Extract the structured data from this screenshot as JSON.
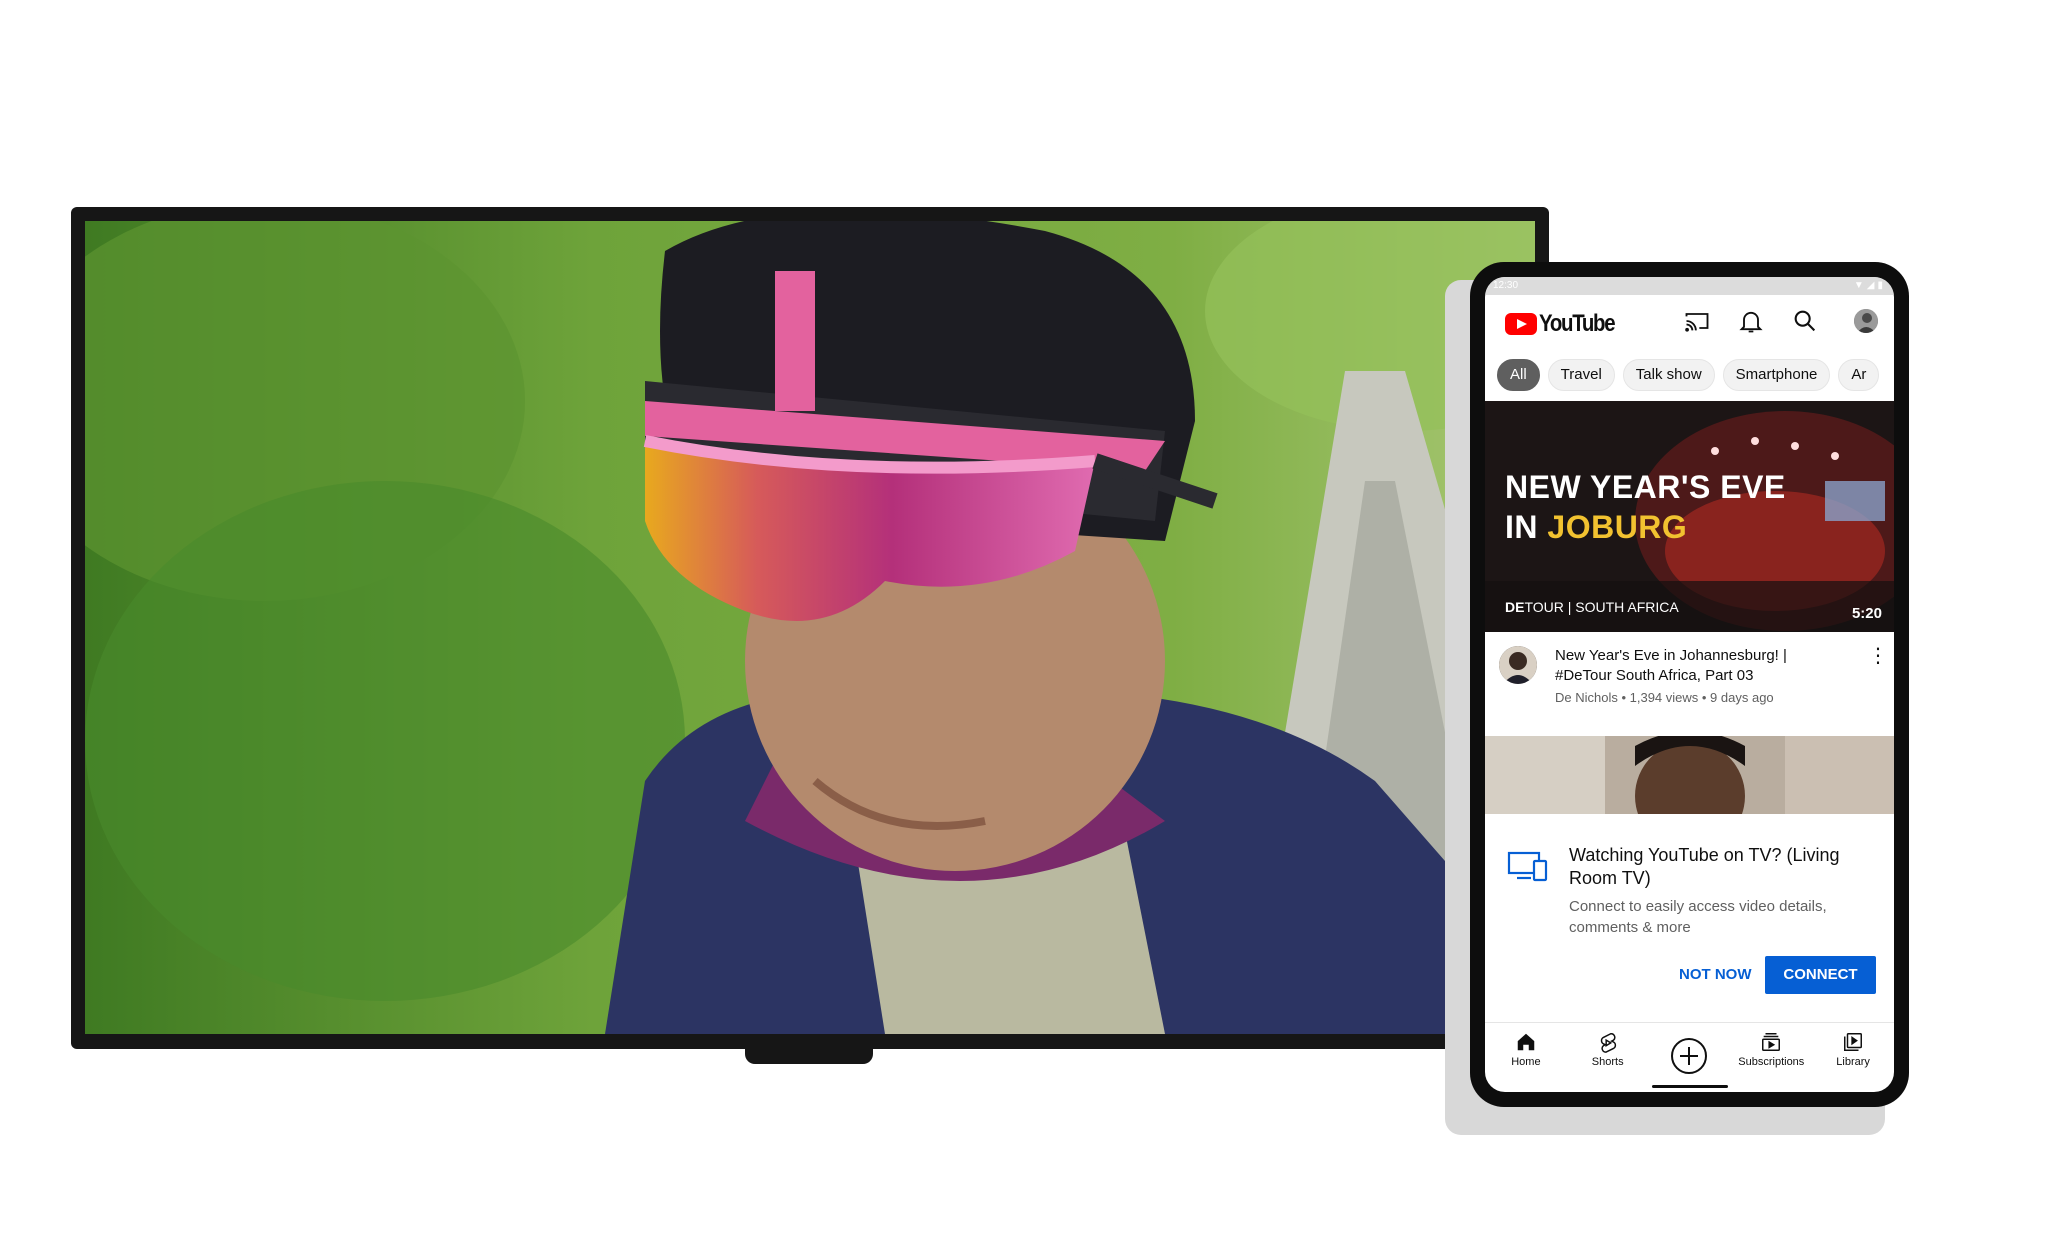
{
  "status_bar": {
    "time": "12:30",
    "icons": "▼◢▮"
  },
  "app": {
    "logo_text": "YouTube",
    "appbar_icons": [
      "cast-icon",
      "bell-icon",
      "search-icon",
      "avatar"
    ]
  },
  "chips": [
    "All",
    "Travel",
    "Talk show",
    "Smartphone",
    "Ar"
  ],
  "featured_video": {
    "thumb_line1": "NEW YEAR'S EVE",
    "thumb_line2_prefix": "IN ",
    "thumb_line2_highlight": "JOBURG",
    "thumb_brand_bold": "DE",
    "thumb_brand_rest": "TOUR | SOUTH AFRICA",
    "duration": "5:20",
    "title": "New Year's Eve in Johannesburg! | #DeTour South Africa, Part 03",
    "subtitle": "De Nichols • 1,394 views • 9 days ago",
    "menu_glyph": "⋮"
  },
  "tv_dialog": {
    "title": "Watching YouTube on TV? (Living Room TV)",
    "body": "Connect to easily access video details, comments & more",
    "not_now": "NOT NOW",
    "connect": "CONNECT"
  },
  "bottom_nav": {
    "home": "Home",
    "shorts": "Shorts",
    "subscriptions": "Subscriptions",
    "library": "Library"
  },
  "colors": {
    "accent_blue": "#065fd4",
    "youtube_red": "#ff0000",
    "thumb_highlight": "#f2c230"
  }
}
